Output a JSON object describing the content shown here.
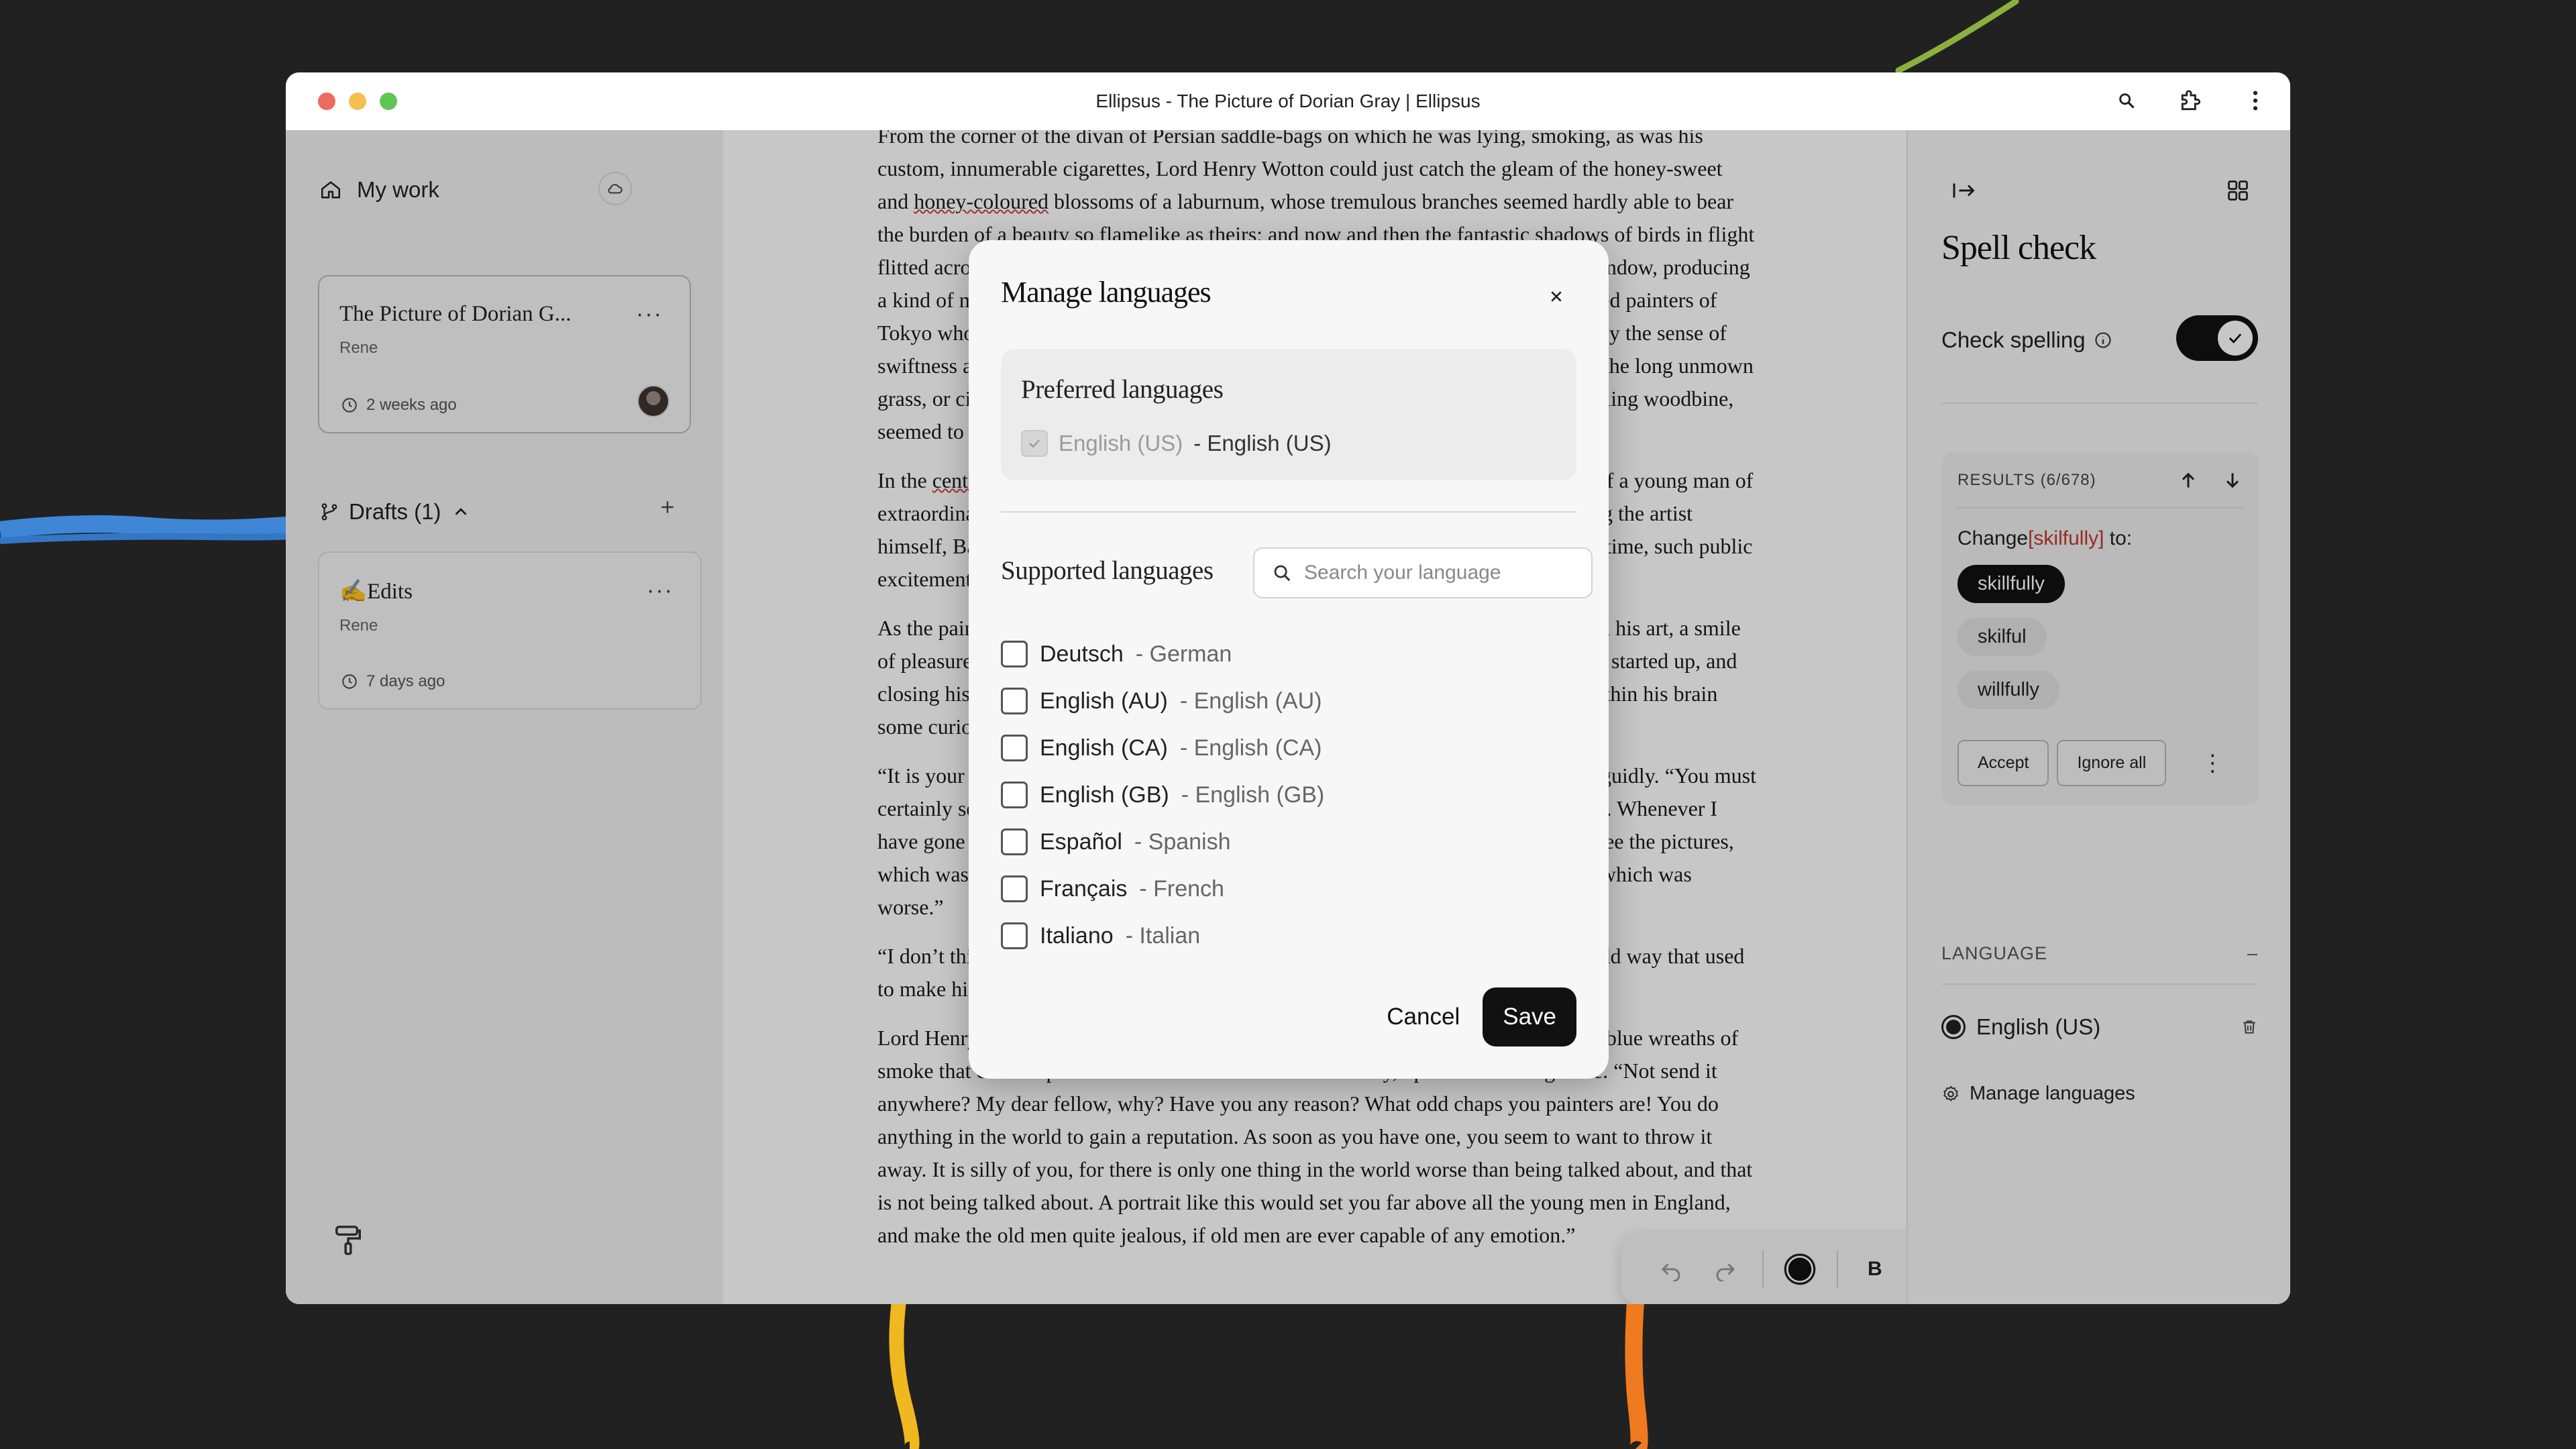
{
  "window": {
    "title": "Ellipsus - The Picture of Dorian Gray | Ellipsus"
  },
  "sidebar": {
    "my_work": "My work",
    "document_card": {
      "title": "The Picture of Dorian G...",
      "author": "Rene",
      "time": "2 weeks ago"
    },
    "drafts_label": "Drafts (1)",
    "draft_card": {
      "title": "✍️Edits",
      "author": "Rene",
      "time": "7 days ago"
    }
  },
  "document": {
    "paragraphs": [
      {
        "parts": [
          {
            "text": "From the corner of the divan of Persian saddle-bags on which he was lying, smoking, as was his custom, innumerable cigarettes, Lord Henry Wotton could just catch the gleam of the honey-sweet and ",
            "err": false
          },
          {
            "text": "honey-coloured",
            "err": true
          },
          {
            "text": " blossoms of a laburnum, whose tremulous branches seemed hardly able to bear the burden of a beauty so ",
            "err": false
          },
          {
            "text": "flamelike",
            "err": true
          },
          {
            "text": " as theirs; and now and then the fantastic shadows of birds in flight flitted across the long tussore-silk curtains that were stretched in front of the huge window, producing a kind of momentary Japanese effect, and making him think of those pallid, jade-faced painters of Tokyo who, through the medium of an art that is necessarily immobile, seek to convey the sense of swiftness and motion. The sullen murmur of the bees shouldering their way through the long unmown grass, or circling with monotonous insistence round the dusty gilt horns of the straggling woodbine, seemed to make the stillness more oppressive.",
            "err": false
          }
        ]
      },
      {
        "parts": [
          {
            "text": "In the ",
            "err": false
          },
          {
            "text": "centre",
            "err": true
          },
          {
            "text": " of the room, clamped to an upright easel, stood the full-length portrait of a young man of extraordinary personal beauty, and in front of it, some little distance away, was sitting the artist himself, Basil Hallward, whose sudden disappearance some years ago caused, at the time, such public excitement and gave rise to so many strange conjectures.",
            "err": false
          }
        ]
      },
      {
        "parts": [
          {
            "text": "As the painter looked at the gracious and comely form he had so skilfully mirrored in his art, a smile of pleasure passed across his face, and seemed about to linger there. But he suddenly started up, and closing his eyes, placed his fingers upon the lids, as though he sought to imprison within his brain some curious dream from which he feared he might awake.",
            "err": false
          }
        ]
      },
      {
        "parts": [
          {
            "text": "“It is your best work, Basil, the best thing you have ever done,” said Lord Henry languidly. “You must certainly send it next year to the Grosvenor. The Academy is too large and too vulgar. Whenever I have gone there, there have been either so many people that I have not been able to see the pictures, which was dreadful, or so many pictures that I have not been able to see the people, which was worse.”",
            "err": false
          }
        ]
      },
      {
        "parts": [
          {
            "text": "“I don’t think I shall send it anywhere,” he answered, tossing his head back in that odd way that used to make his friends laugh at him at Oxford.",
            "err": false
          }
        ]
      },
      {
        "parts": [
          {
            "text": "Lord Henry elevated his eyebrows and looked at him in amazement through the thin blue wreaths of smoke that curled up in such fanciful whorls from his heavy, opium-tainted cigarette. “Not send it anywhere? My dear fellow, why? Have you any reason? What odd chaps you painters are! You do anything in the world to gain a reputation. As soon as you have one, you seem to want to throw it away. It is silly of you, for there is only one thing in the world worse than being talked about, and that is not being talked about. A portrait like this would set you far above all the young men in England, and make the old men quite jealous, if old men are ever capable of any emotion.”",
            "err": false
          }
        ]
      }
    ]
  },
  "spell_panel": {
    "title": "Spell check",
    "check_spelling_label": "Check spelling",
    "check_spelling_on": true,
    "results_label": "RESULTS (6/678)",
    "change_prefix": "Change",
    "misspelled_word": "[skilfully]",
    "change_suffix": " to:",
    "suggestions": [
      "skillfully",
      "skilful",
      "willfully"
    ],
    "accept_label": "Accept",
    "ignore_all_label": "Ignore all",
    "language_heading": "LANGUAGE",
    "language_collapse": "–",
    "selected_language": "English (US)",
    "manage_languages_label": "Manage languages"
  },
  "modal": {
    "title": "Manage languages",
    "preferred_title": "Preferred languages",
    "preferred_native": "English (US)",
    "preferred_english": "- English (US)",
    "supported_title": "Supported languages",
    "search_placeholder": "Search your language",
    "languages": [
      {
        "native": "Deutsch",
        "english": "- German"
      },
      {
        "native": "English (AU)",
        "english": "- English (AU)"
      },
      {
        "native": "English (CA)",
        "english": "- English (CA)"
      },
      {
        "native": "English (GB)",
        "english": "- English (GB)"
      },
      {
        "native": "Español",
        "english": "- Spanish"
      },
      {
        "native": "Français",
        "english": "- French"
      },
      {
        "native": "Italiano",
        "english": "- Italian"
      }
    ],
    "cancel_label": "Cancel",
    "save_label": "Save"
  },
  "colors": {
    "accent": "#111111",
    "error": "#c0392b",
    "traffic_red": "#ed6a5e",
    "traffic_yellow": "#f5bf4f",
    "traffic_green": "#61c554"
  }
}
